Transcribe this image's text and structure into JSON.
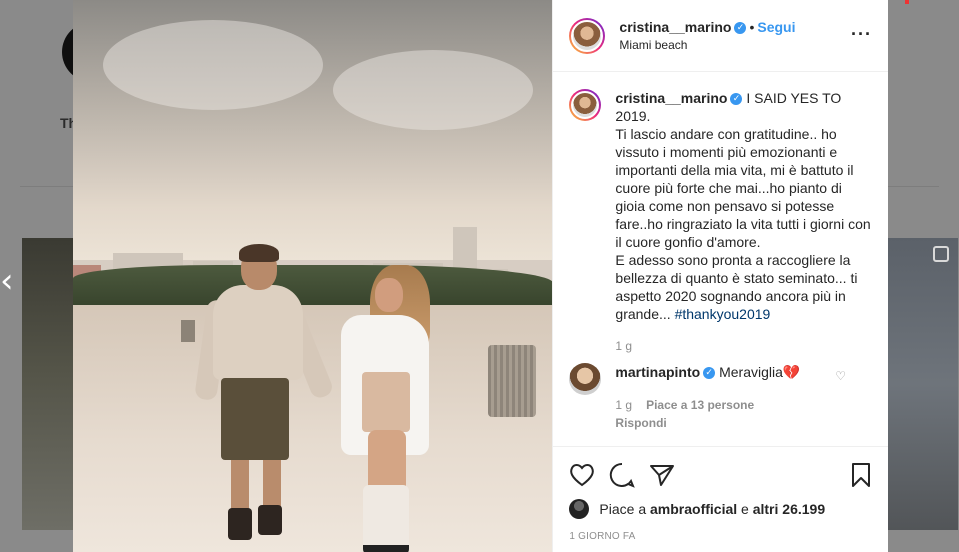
{
  "background": {
    "profile_name_fragment": "Th",
    "nav_prev_icon": "chevron-left-icon"
  },
  "post": {
    "username": "cristina__marino",
    "verified": true,
    "follow_label": "Segui",
    "separator": "•",
    "location": "Miami beach",
    "more_icon": "more-options-icon",
    "more_label": "···"
  },
  "caption": {
    "username": "cristina__marino",
    "text_main": "I SAID YES TO 2019.\nTi lascio andare con gratitudine.. ho vissuto i momenti più emozionanti e importanti della mia vita, mi è battuto il cuore più forte che mai...ho pianto di gioia come non pensavo si potesse fare..ho ringraziato la vita tutti i giorni con il cuore gonfio d'amore.\nE adesso sono pronta a raccogliere la bellezza di quanto è stato seminato... ti aspetto 2020 sognando ancora più in grande... ",
    "hashtag": "#thankyou2019",
    "time": "1 g"
  },
  "comment": {
    "username": "martinapinto",
    "text": "Meraviglia",
    "emoji": "💔",
    "time": "1 g",
    "likes": "Piace a 13 persone",
    "reply": "Rispondi"
  },
  "actions": {
    "like_icon": "heart-icon",
    "comment_icon": "comment-icon",
    "share_icon": "share-icon",
    "save_icon": "bookmark-icon",
    "likes_prefix": "Piace a ",
    "likes_user": "ambraofficial",
    "likes_middle": " e ",
    "likes_others": "altri 26.199",
    "timestamp": "1 giorno fa"
  },
  "colors": {
    "link_blue": "#3897f0",
    "text": "#262626",
    "muted": "#8e8e8e",
    "hashtag": "#00376b"
  }
}
